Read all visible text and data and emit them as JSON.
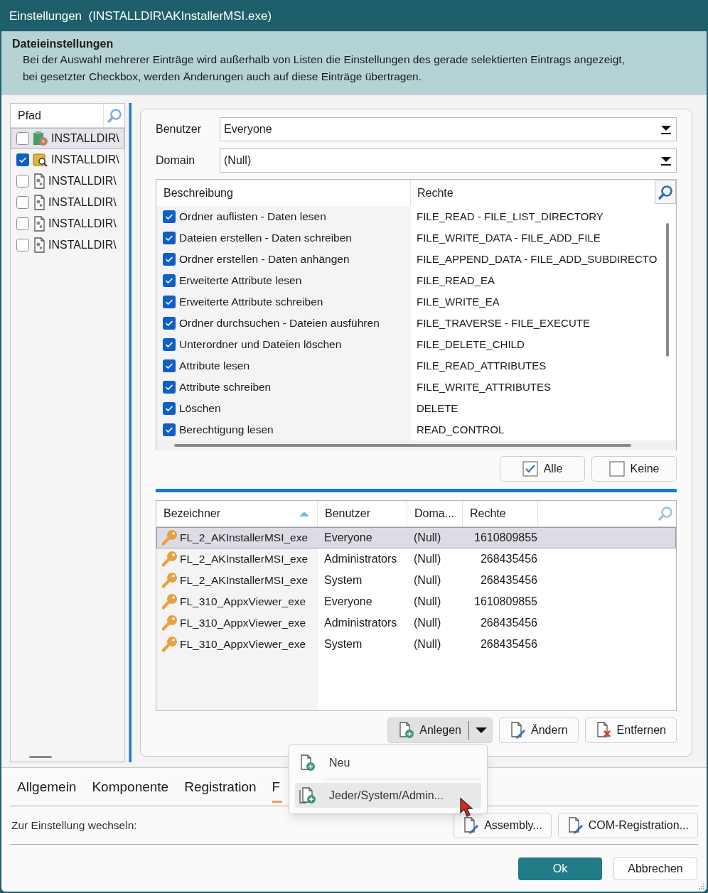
{
  "window": {
    "title": "Einstellungen  (INSTALLDIR\\AKInstallerMSI.exe)"
  },
  "header": {
    "title": "Dateieinstellungen",
    "description": [
      "Bei der Auswahl mehrerer Einträge wird außerhalb von Listen die Einstellungen des gerade selektierten Eintrags angezeigt,",
      "bei gesetzter Checkbox, werden Änderungen auch auf diese Einträge übertragen."
    ]
  },
  "file_list": {
    "column": "Pfad",
    "items": [
      {
        "kind": "package",
        "label": "INSTALLDIR\\",
        "checked": false,
        "selected": true
      },
      {
        "kind": "config-search",
        "label": "INSTALLDIR\\",
        "checked": true,
        "selected": false
      },
      {
        "kind": "gear-file",
        "label": "INSTALLDIR\\",
        "checked": false,
        "selected": false
      },
      {
        "kind": "gear-file",
        "label": "INSTALLDIR\\",
        "checked": false,
        "selected": false
      },
      {
        "kind": "gear-file",
        "label": "INSTALLDIR\\",
        "checked": false,
        "selected": false
      },
      {
        "kind": "gear-file",
        "label": "INSTALLDIR\\",
        "checked": false,
        "selected": false
      }
    ]
  },
  "permissions": {
    "user_label": "Benutzer",
    "user": "Everyone",
    "domain_label": "Domain",
    "domain": "(Null)",
    "columns": [
      "Beschreibung",
      "Rechte"
    ],
    "rows": [
      {
        "description": "Ordner auflisten - Daten lesen",
        "rights": "FILE_READ - FILE_LIST_DIRECTORY",
        "checked": true
      },
      {
        "description": "Dateien erstellen - Daten schreiben",
        "rights": "FILE_WRITE_DATA - FILE_ADD_FILE",
        "checked": true
      },
      {
        "description": "Ordner erstellen - Daten anhängen",
        "rights": "FILE_APPEND_DATA - FILE_ADD_SUBDIRECTO",
        "checked": true
      },
      {
        "description": "Erweiterte Attribute lesen",
        "rights": "FILE_READ_EA",
        "checked": true
      },
      {
        "description": "Erweiterte Attribute schreiben",
        "rights": "FILE_WRITE_EA",
        "checked": true
      },
      {
        "description": "Ordner durchsuchen - Dateien ausführen",
        "rights": "FILE_TRAVERSE - FILE_EXECUTE",
        "checked": true
      },
      {
        "description": "Unterordner und Dateien löschen",
        "rights": "FILE_DELETE_CHILD",
        "checked": true
      },
      {
        "description": "Attribute lesen",
        "rights": "FILE_READ_ATTRIBUTES",
        "checked": true
      },
      {
        "description": "Attribute schreiben",
        "rights": "FILE_WRITE_ATTRIBUTES",
        "checked": true
      },
      {
        "description": "Löschen",
        "rights": "DELETE",
        "checked": true
      },
      {
        "description": "Berechtigung lesen",
        "rights": "READ_CONTROL",
        "checked": true
      }
    ],
    "buttons": [
      {
        "label": "Alle",
        "kind": "check-all"
      },
      {
        "label": "Keine",
        "kind": "check-none"
      }
    ]
  },
  "entries": {
    "columns": [
      {
        "label": "Bezeichner",
        "sorted": true
      },
      {
        "label": "Benutzer",
        "sorted": false
      },
      {
        "label": "Doma...",
        "sorted": false
      },
      {
        "label": "Rechte",
        "sorted": false
      }
    ],
    "rows": [
      {
        "name": "FL_2_AKInstallerMSI_exe",
        "user": "Everyone",
        "domain": "(Null)",
        "rights": "1610809855",
        "selected": true
      },
      {
        "name": "FL_2_AKInstallerMSI_exe",
        "user": "Administrators",
        "domain": "(Null)",
        "rights": "268435456",
        "selected": false
      },
      {
        "name": "FL_2_AKInstallerMSI_exe",
        "user": "System",
        "domain": "(Null)",
        "rights": "268435456",
        "selected": false
      },
      {
        "name": "FL_310_AppxViewer_exe",
        "user": "Everyone",
        "domain": "(Null)",
        "rights": "1610809855",
        "selected": false
      },
      {
        "name": "FL_310_AppxViewer_exe",
        "user": "Administrators",
        "domain": "(Null)",
        "rights": "268435456",
        "selected": false
      },
      {
        "name": "FL_310_AppxViewer_exe",
        "user": "System",
        "domain": "(Null)",
        "rights": "268435456",
        "selected": false
      }
    ],
    "buttons": [
      {
        "label": "Anlegen",
        "kind": "add",
        "pressed": true
      },
      {
        "label": "Ändern",
        "kind": "edit",
        "pressed": false
      },
      {
        "label": "Entfernen",
        "kind": "remove",
        "pressed": false
      }
    ]
  },
  "dropdown_menu": {
    "items": [
      {
        "label": "Neu",
        "kind": "add",
        "highlighted": false
      },
      {
        "label": "Jeder/System/Admin...",
        "kind": "add-multi",
        "highlighted": true
      }
    ]
  },
  "tabs": [
    {
      "label": "Allgemein",
      "selected": false
    },
    {
      "label": "Komponente",
      "selected": false
    },
    {
      "label": "Registration",
      "selected": false
    },
    {
      "label": "F",
      "selected": true
    }
  ],
  "switch_section": {
    "label": "Zur Einstellung wechseln:",
    "buttons": [
      "Assembly...",
      "COM-Registration..."
    ]
  },
  "footer": {
    "buttons": [
      {
        "label": "Ok",
        "kind": "primary"
      },
      {
        "label": "Abbrechen",
        "kind": "secondary"
      }
    ]
  }
}
